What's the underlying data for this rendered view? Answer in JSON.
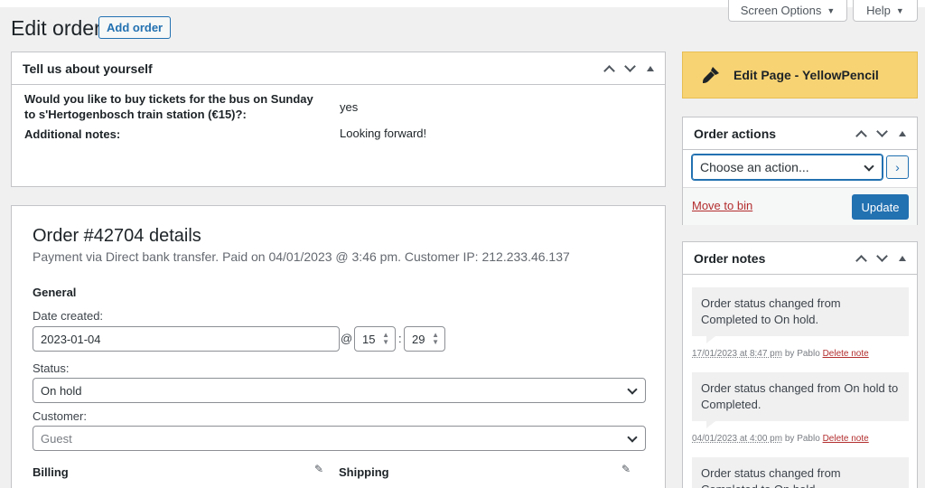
{
  "screen_meta": {
    "screen_options": "Screen Options",
    "help": "Help"
  },
  "header": {
    "title": "Edit order",
    "add_button": "Add order"
  },
  "about_box": {
    "title": "Tell us about yourself",
    "questions": [
      {
        "label": "Would you like to buy tickets for the bus on Sunday to s'Hertogenbosch train station (€15)?:",
        "answer": "yes"
      },
      {
        "label": "Additional notes:",
        "answer": "Looking forward!"
      }
    ]
  },
  "order": {
    "title": "Order #42704 details",
    "subtitle": "Payment via Direct bank transfer. Paid on 04/01/2023 @ 3:46 pm. Customer IP: 212.233.46.137",
    "general_title": "General",
    "date_label": "Date created:",
    "date_value": "2023-01-04",
    "at": "@",
    "hour": "15",
    "minute": "29",
    "colon": ":",
    "status_label": "Status:",
    "status_value": "On hold",
    "customer_label": "Customer:",
    "customer_placeholder": "Guest",
    "billing_title": "Billing",
    "shipping_title": "Shipping"
  },
  "yellowpencil": {
    "label": "Edit Page - YellowPencil"
  },
  "order_actions": {
    "title": "Order actions",
    "select_value": "Choose an action...",
    "go": "›",
    "move_to_bin": "Move to bin",
    "update": "Update"
  },
  "order_notes": {
    "title": "Order notes",
    "notes": [
      {
        "text": "Order status changed from Completed to On hold.",
        "timestamp": "17/01/2023 at 8:47 pm",
        "by": "by Pablo",
        "delete": "Delete note"
      },
      {
        "text": "Order status changed from On hold to Completed.",
        "timestamp": "04/01/2023 at 4:00 pm",
        "by": "by Pablo",
        "delete": "Delete note"
      },
      {
        "text": "Order status changed from Completed to On hold.",
        "timestamp": "",
        "by": "",
        "delete": ""
      }
    ]
  },
  "colors": {
    "accent": "#2271b1",
    "danger": "#b32d2e",
    "yellowpencil_bg": "#f8d373"
  },
  "icons": {
    "pencil": "edit-pencil-icon",
    "brush": "paint-brush-icon"
  }
}
